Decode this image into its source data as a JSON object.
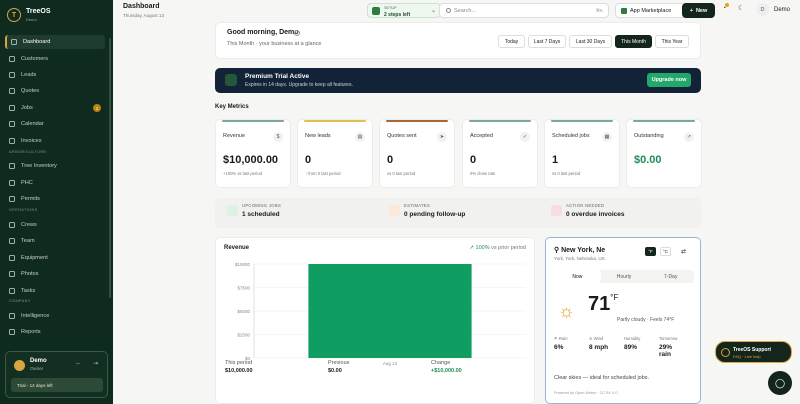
{
  "brand": {
    "name": "TreeOS",
    "sub": "Demo",
    "logo_letter": "T"
  },
  "sidebar": {
    "items": [
      {
        "label": "Dashboard",
        "active": true
      },
      {
        "label": "Customers"
      },
      {
        "label": "Leads"
      },
      {
        "label": "Quotes"
      },
      {
        "label": "Jobs",
        "badge": "1"
      },
      {
        "label": "Calendar"
      },
      {
        "label": "Invoices"
      }
    ],
    "section_arboriculture": "ARBORICULTURE",
    "items2": [
      {
        "label": "Tree Inventory"
      },
      {
        "label": "PHC"
      },
      {
        "label": "Permits"
      }
    ],
    "section_operations": "OPERATIONS",
    "items3": [
      {
        "label": "Crews"
      },
      {
        "label": "Team"
      },
      {
        "label": "Equipment"
      },
      {
        "label": "Photos"
      },
      {
        "label": "Tasks"
      }
    ],
    "section_company": "COMPANY",
    "items4": [
      {
        "label": "Intelligence"
      },
      {
        "label": "Reports"
      }
    ],
    "user": {
      "name": "Demo",
      "role": "Owner",
      "trial": "Trial - 14 days left"
    }
  },
  "topbar": {
    "title": "Dashboard",
    "date": "Thursday, August 13",
    "setup_label": "SETUP",
    "setup_value": "2 steps left",
    "search_placeholder": "Search...",
    "search_kbd": "⌘K",
    "marketplace": "App Marketplace",
    "new_label": "New",
    "user_initial": "D",
    "user_name": "Demo"
  },
  "greeting": {
    "title": "Good morning, Demo",
    "subtitle": "This Month · your business at a glance",
    "ranges": [
      "Today",
      "Last 7 Days",
      "Last 30 Days",
      "This Month",
      "This Year"
    ],
    "active_range": "This Month"
  },
  "banner": {
    "title": "Premium Trial Active",
    "subtitle": "Expires in 14 days. Upgrade to keep all features.",
    "button": "Upgrade now"
  },
  "metrics_title": "Key Metrics",
  "metrics": [
    {
      "label": "Revenue",
      "value": "$10,000.00",
      "sub": "+100% vs last period",
      "color": "#7aa7a0",
      "icon": "$"
    },
    {
      "label": "New leads",
      "value": "0",
      "sub": "↑ from 0 last period",
      "color": "#e3c04a",
      "icon": "▤"
    },
    {
      "label": "Quotes sent",
      "value": "0",
      "sub": "vs 0 last period",
      "color": "#a66a3a",
      "icon": "➤"
    },
    {
      "label": "Accepted",
      "value": "0",
      "sub": "0% close rate",
      "color": "#7aa7a0",
      "icon": "✓"
    },
    {
      "label": "Scheduled jobs",
      "value": "1",
      "sub": "vs 0 last period",
      "color": "#7aa7a0",
      "icon": "▦"
    },
    {
      "label": "Outstanding",
      "value": "$0.00",
      "sub": "",
      "color": "#7aa7a0",
      "icon": "↗",
      "green": true
    }
  ],
  "status": [
    {
      "label": "UPCOMING JOBS",
      "value": "1 scheduled",
      "color": "#dff1e3"
    },
    {
      "label": "ESTIMATES",
      "value": "0 pending follow-up",
      "color": "#fbe8d6"
    },
    {
      "label": "ACTION NEEDED",
      "value": "0 overdue invoices",
      "color": "#f8dede"
    }
  ],
  "revenue": {
    "title": "Revenue",
    "change": "100%",
    "change_suffix": "vs prior period",
    "this_period_label": "This period",
    "this_period": "$10,000.00",
    "previous_label": "Previous",
    "previous": "$0.00",
    "change_label": "Change",
    "change_value": "+$10,000.00"
  },
  "chart_data": {
    "type": "bar",
    "categories": [
      "Aug 13"
    ],
    "values": [
      10000
    ],
    "ylim": [
      0,
      10000
    ],
    "yticks": [
      "$10000",
      "$7500",
      "$5000",
      "$2500",
      "$0"
    ],
    "color": "#0f9d62"
  },
  "weather": {
    "city": "New York, Ne",
    "region": "York, York, Nebraska, US",
    "units": [
      "°F",
      "°C"
    ],
    "active_unit": "°F",
    "tabs": [
      "Now",
      "Hourly",
      "7-Day"
    ],
    "active_tab": "Now",
    "temp": "71",
    "temp_unit": "°F",
    "condition": "Partly cloudy · Feels 74°F",
    "stats": [
      {
        "label": "Rain",
        "value": "6%"
      },
      {
        "label": "Wind",
        "value": "8 mph"
      },
      {
        "label": "Humidity",
        "value": "89%"
      },
      {
        "label": "Tomorrow",
        "value": "29% rain"
      }
    ],
    "note": "Clear skies — ideal for scheduled jobs.",
    "credit": "Powered by Open-Meteo · CC BY 4.0"
  },
  "support": {
    "title": "TreeOS Support",
    "sub": "FAQ · Live help"
  }
}
